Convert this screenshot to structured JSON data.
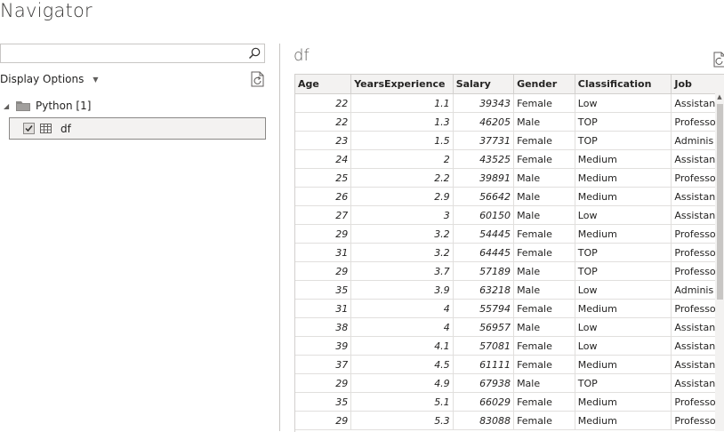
{
  "window": {
    "title": "Navigator"
  },
  "left_pane": {
    "search": {
      "value": "",
      "placeholder": "",
      "icon": "search-icon"
    },
    "display_options_label": "Display Options",
    "tree": {
      "root_label": "Python [1]",
      "items": [
        {
          "label": "df",
          "checked": true,
          "selected": true
        }
      ]
    }
  },
  "preview": {
    "title": "df",
    "columns": [
      "Age",
      "YearsExperience",
      "Salary",
      "Gender",
      "Classification",
      "Job"
    ],
    "rows": [
      [
        "22",
        "1.1",
        "39343",
        "Female",
        "Low",
        "Assistan"
      ],
      [
        "22",
        "1.3",
        "46205",
        "Male",
        "TOP",
        "Professo"
      ],
      [
        "23",
        "1.5",
        "37731",
        "Female",
        "TOP",
        "Adminis"
      ],
      [
        "24",
        "2",
        "43525",
        "Female",
        "Medium",
        "Assistan"
      ],
      [
        "25",
        "2.2",
        "39891",
        "Male",
        "Medium",
        "Professo"
      ],
      [
        "26",
        "2.9",
        "56642",
        "Male",
        "Medium",
        "Assistan"
      ],
      [
        "27",
        "3",
        "60150",
        "Male",
        "Low",
        "Assistan"
      ],
      [
        "29",
        "3.2",
        "54445",
        "Female",
        "Medium",
        "Professo"
      ],
      [
        "31",
        "3.2",
        "64445",
        "Female",
        "TOP",
        "Professo"
      ],
      [
        "29",
        "3.7",
        "57189",
        "Male",
        "TOP",
        "Professo"
      ],
      [
        "35",
        "3.9",
        "63218",
        "Male",
        "Low",
        "Adminis"
      ],
      [
        "31",
        "4",
        "55794",
        "Female",
        "Medium",
        "Professo"
      ],
      [
        "38",
        "4",
        "56957",
        "Male",
        "Low",
        "Assistan"
      ],
      [
        "39",
        "4.1",
        "57081",
        "Female",
        "Low",
        "Assistan"
      ],
      [
        "37",
        "4.5",
        "61111",
        "Female",
        "Medium",
        "Assistan"
      ],
      [
        "29",
        "4.9",
        "67938",
        "Male",
        "TOP",
        "Assistan"
      ],
      [
        "35",
        "5.1",
        "66029",
        "Female",
        "Medium",
        "Professo"
      ],
      [
        "29",
        "5.3",
        "83088",
        "Female",
        "Medium",
        "Professo"
      ]
    ]
  }
}
